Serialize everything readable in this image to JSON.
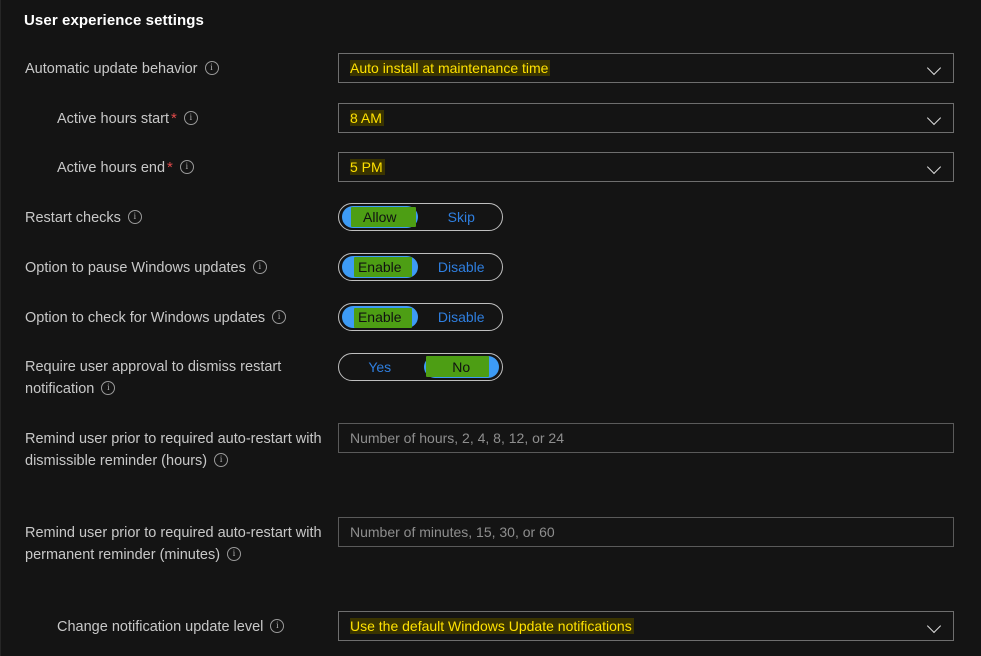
{
  "page": {
    "title": "User experience settings"
  },
  "icons": {
    "info": "info-circle-icon",
    "chevron": "chevron-down-icon",
    "required": "*"
  },
  "rows": [
    {
      "id": "automatic-update-behavior",
      "label": "Automatic update behavior",
      "required": false,
      "indent": false,
      "control": "dropdown",
      "value": "Auto install at maintenance time"
    },
    {
      "id": "active-hours-start",
      "label": "Active hours start",
      "required": true,
      "indent": true,
      "control": "dropdown",
      "value": "8 AM"
    },
    {
      "id": "active-hours-end",
      "label": "Active hours end",
      "required": true,
      "indent": true,
      "control": "dropdown",
      "value": "5 PM"
    },
    {
      "id": "restart-checks",
      "label": "Restart checks",
      "required": false,
      "indent": false,
      "control": "segmented",
      "options": [
        "Allow",
        "Skip"
      ],
      "selected": "Allow"
    },
    {
      "id": "option-to-pause-windows-updates",
      "label": "Option to pause Windows updates",
      "required": false,
      "indent": false,
      "control": "segmented",
      "options": [
        "Enable",
        "Disable"
      ],
      "selected": "Enable"
    },
    {
      "id": "option-to-check-for-windows-updates",
      "label": "Option to check for Windows updates",
      "required": false,
      "indent": false,
      "control": "segmented",
      "options": [
        "Enable",
        "Disable"
      ],
      "selected": "Enable"
    },
    {
      "id": "require-user-approval-to-dismiss-restart-notification",
      "label": "Require user approval to dismiss restart notification",
      "required": false,
      "indent": false,
      "control": "segmented",
      "options": [
        "Yes",
        "No"
      ],
      "selected": "No"
    },
    {
      "id": "remind-user-dismissible-reminder-hours",
      "label": "Remind user prior to required auto-restart with dismissible reminder (hours)",
      "required": false,
      "indent": false,
      "control": "textfield",
      "value": "",
      "placeholder": "Number of hours, 2, 4, 8, 12, or 24"
    },
    {
      "id": "remind-user-permanent-reminder-minutes",
      "label": "Remind user prior to required auto-restart with permanent reminder (minutes)",
      "required": false,
      "indent": false,
      "control": "textfield",
      "value": "",
      "placeholder": "Number of minutes, 15, 30, or 60"
    },
    {
      "id": "change-notification-update-level",
      "label": "Change notification update level",
      "required": false,
      "indent": true,
      "control": "dropdown",
      "value": "Use the default Windows Update notifications"
    }
  ],
  "colors": {
    "background": "#141414",
    "dropdown_value": "#ffe200",
    "segment_selected": "#3d9bf5",
    "segment_text": "#2f7fe0",
    "highlight_green": "#4d9e14",
    "required_star": "#e04a4a",
    "label_text": "#c8c8c8",
    "placeholder_text": "#8e8e8e"
  }
}
